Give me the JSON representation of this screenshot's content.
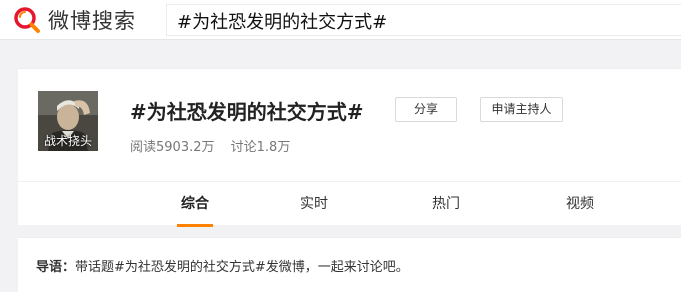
{
  "header": {
    "logo_text": "微博搜索",
    "search_query": "#为社恐发明的社交方式#"
  },
  "topic": {
    "avatar_caption": "战术挠头",
    "title": "#为社恐发明的社交方式#",
    "share_label": "分享",
    "host_label": "申请主持人",
    "reads": "阅读5903.2万",
    "discussions": "讨论1.8万"
  },
  "tabs": [
    {
      "label": "综合",
      "active": true
    },
    {
      "label": "实时",
      "active": false
    },
    {
      "label": "热门",
      "active": false
    },
    {
      "label": "视频",
      "active": false
    }
  ],
  "intro": {
    "label": "导语：",
    "text": "带话题#为社恐发明的社交方式#发微博，一起来讨论吧。"
  },
  "colors": {
    "brand": "#ff8200",
    "logo_red": "#e6162d"
  }
}
